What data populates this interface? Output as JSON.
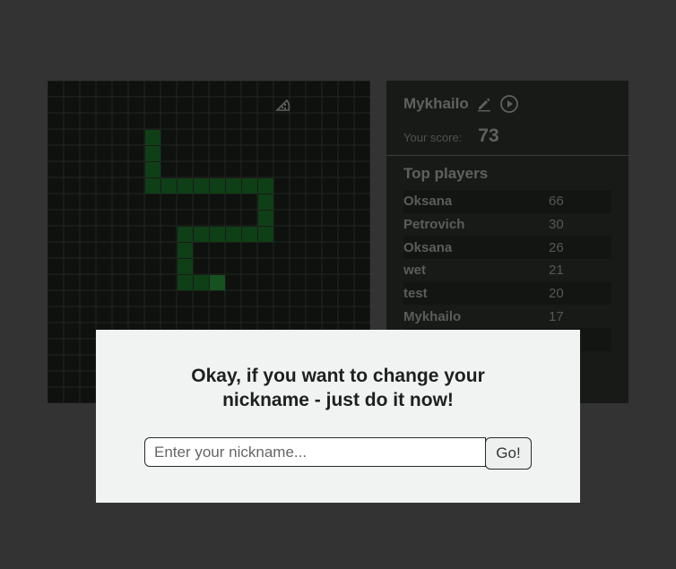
{
  "board": {
    "cols": 20,
    "rows": 20,
    "grid_color": "#232723",
    "cell_color": "#0e110e",
    "snake_color": "#0f3f16",
    "snake_head_color": "#16521f",
    "snake_cells": [
      [
        6,
        3
      ],
      [
        6,
        4
      ],
      [
        6,
        5
      ],
      [
        6,
        6
      ],
      [
        7,
        6
      ],
      [
        8,
        6
      ],
      [
        9,
        6
      ],
      [
        10,
        6
      ],
      [
        11,
        6
      ],
      [
        12,
        6
      ],
      [
        13,
        6
      ],
      [
        13,
        7
      ],
      [
        13,
        8
      ],
      [
        13,
        9
      ],
      [
        12,
        9
      ],
      [
        11,
        9
      ],
      [
        10,
        9
      ],
      [
        9,
        9
      ],
      [
        8,
        9
      ],
      [
        8,
        10
      ],
      [
        8,
        11
      ],
      [
        8,
        12
      ],
      [
        9,
        12
      ],
      [
        10,
        12
      ]
    ],
    "food_icon": "pizza-icon",
    "food_cell": [
      14,
      1
    ]
  },
  "player": {
    "name": "Mykhailo",
    "edit_icon": "pencil-icon",
    "play_icon": "play-circle-icon",
    "score_label": "Your score:",
    "score": "73"
  },
  "top_players": {
    "title": "Top players",
    "rows": [
      {
        "name": "Oksana",
        "score": "66"
      },
      {
        "name": "Petrovich",
        "score": "30"
      },
      {
        "name": "Oksana",
        "score": "26"
      },
      {
        "name": "wet",
        "score": "21"
      },
      {
        "name": "test",
        "score": "20"
      },
      {
        "name": "Mykhailo",
        "score": "17"
      },
      {
        "name": "",
        "score": ""
      }
    ]
  },
  "modal": {
    "title_line1": "Okay, if you want to change your",
    "title_line2": "nickname - just do it now!",
    "input_placeholder": "Enter your nickname...",
    "input_value": "",
    "go_label": "Go!"
  },
  "colors": {
    "page_bg": "#333333",
    "modal_bg": "#f1f3f2"
  }
}
